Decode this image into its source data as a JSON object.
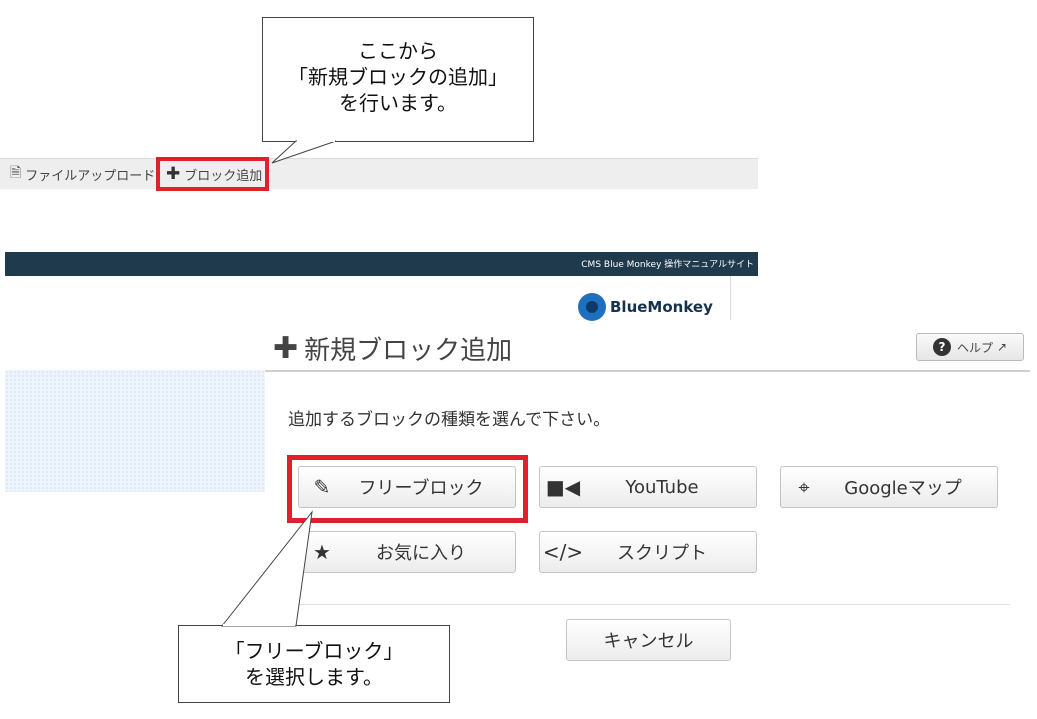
{
  "callouts": {
    "top": "ここから\n「新規ブロックの追加」\nを行います。",
    "bottom": "「フリーブロック」\nを選択します。"
  },
  "toolbar": {
    "file_upload": "ファイルアップロード",
    "add_block": "ブロック追加"
  },
  "site": {
    "header_text": "CMS Blue Monkey 操作マニュアルサイト",
    "logo": "BlueMonkey"
  },
  "modal": {
    "title": "新規ブロック追加",
    "help_label": "ヘルプ",
    "prompt": "追加するブロックの種類を選んで下さい。",
    "buttons": {
      "free_block": "フリーブロック",
      "youtube": "YouTube",
      "google_map": "Googleマップ",
      "favorites": "お気に入り",
      "script": "スクリプト",
      "cancel": "キャンセル"
    }
  },
  "colors": {
    "highlight": "#e0202a",
    "site_bar": "#1f3a4d"
  },
  "icons": [
    "file-icon",
    "plus-icon",
    "pencil-icon",
    "video-camera-icon",
    "crosshair-icon",
    "star-icon",
    "code-icon",
    "question-icon",
    "external-link-icon"
  ]
}
